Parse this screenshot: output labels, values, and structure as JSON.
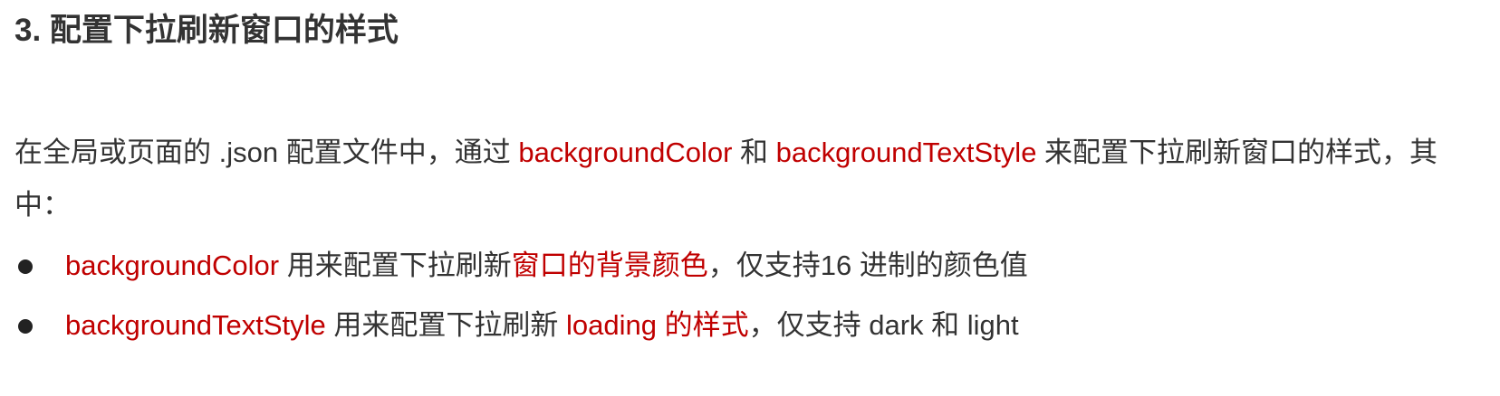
{
  "heading": "3. 配置下拉刷新窗口的样式",
  "paragraph": {
    "part1": "在全局或页面的 .json 配置文件中，通过 ",
    "prop1": "backgroundColor",
    "part2": " 和 ",
    "prop2": "backgroundTextStyle",
    "part3": " 来配置下拉刷新窗口的样式，其中："
  },
  "bullets": [
    {
      "prop": "backgroundColor",
      "text1": " 用来配置下拉刷新",
      "highlight": "窗口的背景颜色",
      "text2": "，仅支持16 进制的颜色值"
    },
    {
      "prop": "backgroundTextStyle",
      "text1": " 用来配置下拉刷新 ",
      "highlight": "loading 的样式",
      "text2": "，仅支持 dark 和 light"
    }
  ],
  "colors": {
    "text": "#333333",
    "highlight": "#c00000",
    "bullet": "#222222"
  }
}
